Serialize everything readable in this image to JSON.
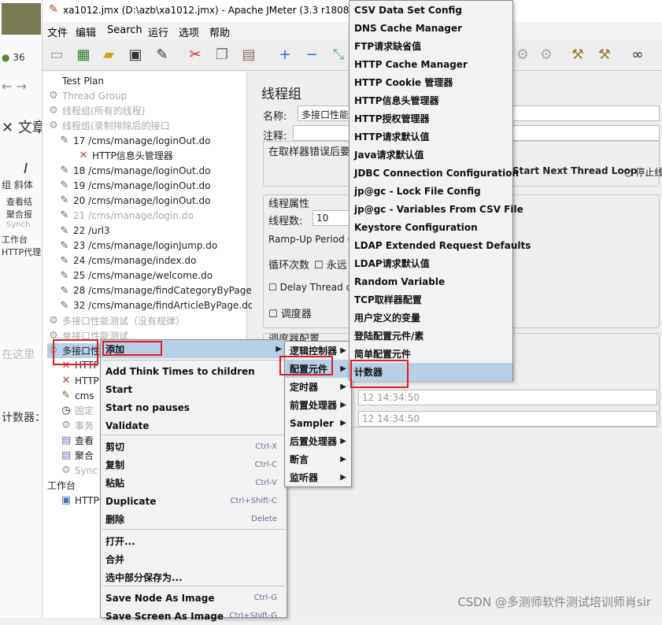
{
  "window": {
    "title": "xa1012.jmx (D:\\azb\\xa1012.jmx) - Apache JMeter (3.3 r1808647)"
  },
  "menubar": [
    "文件",
    "编辑",
    "Search",
    "运行",
    "选项",
    "帮助"
  ],
  "background_app": {
    "number": "36",
    "items": [
      "文章",
      "斜体",
      "组",
      "查看结",
      "聚合报",
      "Synch",
      "工作台",
      "HTTP代理",
      "在这里",
      "计数器："
    ]
  },
  "tree": {
    "items": [
      {
        "label": "Test Plan",
        "icon": "test-plan-icon",
        "enabled": true
      },
      {
        "label": "Thread Group",
        "icon": "gear-icon",
        "enabled": false
      },
      {
        "label": "线程组(所有的线程)",
        "icon": "gear-icon",
        "enabled": false
      },
      {
        "label": "线程组(录制排除后的接口",
        "icon": "gear-icon",
        "enabled": false
      },
      {
        "label": "17 /cms/manage/loginOut.do",
        "icon": "pen-icon",
        "enabled": true
      },
      {
        "label": "HTTP信息头管理器",
        "icon": "wrench-icon",
        "enabled": true
      },
      {
        "label": "18 /cms/manage/loginOut.do",
        "icon": "pen-icon",
        "enabled": true
      },
      {
        "label": "19 /cms/manage/loginOut.do",
        "icon": "pen-icon",
        "enabled": true
      },
      {
        "label": "20 /cms/manage/loginOut.do",
        "icon": "pen-icon",
        "enabled": true
      },
      {
        "label": "21 /cms/manage/login.do",
        "icon": "pen-icon",
        "enabled": false
      },
      {
        "label": "22 /url3",
        "icon": "pen-icon",
        "enabled": true
      },
      {
        "label": "23 /cms/manage/loginJump.do",
        "icon": "pen-icon",
        "enabled": true
      },
      {
        "label": "24 /cms/manage/index.do",
        "icon": "pen-icon",
        "enabled": true
      },
      {
        "label": "25 /cms/manage/welcome.do",
        "icon": "pen-icon",
        "enabled": true
      },
      {
        "label": "28 /cms/manage/findCategoryByPage.",
        "icon": "pen-icon",
        "enabled": true
      },
      {
        "label": "32 /cms/manage/findArticleByPage.do",
        "icon": "pen-icon",
        "enabled": true
      },
      {
        "label": "多接口性能测试（没有规律）",
        "icon": "gear-icon",
        "enabled": false
      },
      {
        "label": "单接口性能测试",
        "icon": "gear-icon",
        "enabled": false
      },
      {
        "label": "多接口性",
        "icon": "gear-icon",
        "enabled": true
      },
      {
        "label": "HTTP",
        "icon": "wrench-icon",
        "enabled": true
      },
      {
        "label": "HTTP",
        "icon": "wrench-icon",
        "enabled": true
      },
      {
        "label": "cms",
        "icon": "pen-icon",
        "enabled": true
      },
      {
        "label": "固定",
        "icon": "clock-icon",
        "enabled": false
      },
      {
        "label": "事务",
        "icon": "gear-icon",
        "enabled": false
      },
      {
        "label": "查看",
        "icon": "chart-icon",
        "enabled": true
      },
      {
        "label": "聚合",
        "icon": "chart-icon",
        "enabled": true
      },
      {
        "label": "Sync",
        "icon": "gear-icon",
        "enabled": false
      },
      {
        "label": "工作台",
        "icon": "",
        "enabled": true
      },
      {
        "label": "HTTP代",
        "icon": "proxy-icon",
        "enabled": true
      }
    ]
  },
  "panel": {
    "heading": "线程组",
    "name_label": "名称:",
    "name_value": "多接口性能测",
    "comment_label": "注释:",
    "on_error_label": "在取样器错误后要",
    "start_next_label": "Start Next Thread Loop",
    "stop_label": "停止线",
    "thread_props": "线程属性",
    "threads_label": "线程数:",
    "threads_value": "10",
    "rampup_label": "Ramp-Up Period (i",
    "loop_label": "循环次数",
    "forever_label": "永远",
    "delay_label": "Delay Thread c",
    "scheduler_label": "调度器",
    "scheduler_config": "调度器配置",
    "time1": "12 14:34:50",
    "time2": "12 14:34:50"
  },
  "context_menu": {
    "items": [
      {
        "label": "添加",
        "arrow": "▶",
        "shortcut": ""
      },
      {
        "label": "Add Think Times to children",
        "arrow": "",
        "shortcut": ""
      },
      {
        "label": "Start",
        "arrow": "",
        "shortcut": ""
      },
      {
        "label": "Start no pauses",
        "arrow": "",
        "shortcut": ""
      },
      {
        "label": "Validate",
        "arrow": "",
        "shortcut": ""
      },
      {
        "label": "剪切",
        "arrow": "",
        "shortcut": "Ctrl-X"
      },
      {
        "label": "复制",
        "arrow": "",
        "shortcut": "Ctrl-C"
      },
      {
        "label": "粘贴",
        "arrow": "",
        "shortcut": "Ctrl-V"
      },
      {
        "label": "Duplicate",
        "arrow": "",
        "shortcut": "Ctrl+Shift-C"
      },
      {
        "label": "删除",
        "arrow": "",
        "shortcut": "Delete"
      },
      {
        "label": "打开...",
        "arrow": "",
        "shortcut": ""
      },
      {
        "label": "合并",
        "arrow": "",
        "shortcut": ""
      },
      {
        "label": "选中部分保存为...",
        "arrow": "",
        "shortcut": ""
      },
      {
        "label": "Save Node As Image",
        "arrow": "",
        "shortcut": "Ctrl-G"
      },
      {
        "label": "Save Screen As Image",
        "arrow": "",
        "shortcut": "Ctrl+Shift-G"
      }
    ]
  },
  "add_submenu": {
    "items": [
      "逻辑控制器",
      "配置元件",
      "定时器",
      "前置处理器",
      "Sampler",
      "后置处理器",
      "断言",
      "监听器"
    ]
  },
  "config_submenu": {
    "items": [
      "CSV Data Set Config",
      "DNS Cache Manager",
      "FTP请求缺省值",
      "HTTP Cache Manager",
      "HTTP Cookie 管理器",
      "HTTP信息头管理器",
      "HTTP授权管理器",
      "HTTP请求默认值",
      "Java请求默认值",
      "JDBC Connection Configuration",
      "jp@gc - Lock File Config",
      "jp@gc - Variables From CSV File",
      "Keystore Configuration",
      "LDAP Extended Request Defaults",
      "LDAP请求默认值",
      "Random Variable",
      "TCP取样器配置",
      "用户定义的变量",
      "登陆配置元件/素",
      "简单配置元件",
      "计数器"
    ]
  },
  "watermark": "CSDN @多测师软件测试培训师肖sir",
  "colors": {
    "highlight": "#b8cfe5",
    "annotation": "#e31b23"
  }
}
